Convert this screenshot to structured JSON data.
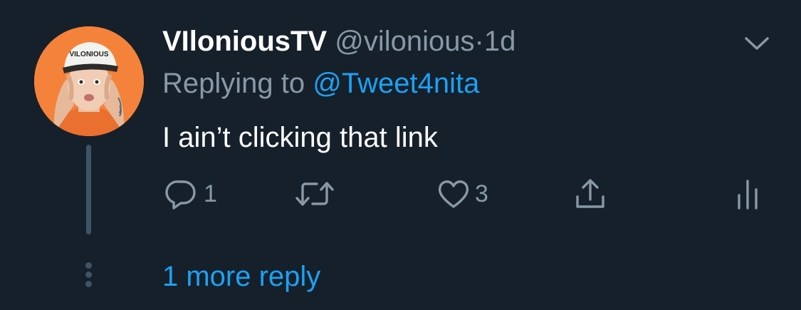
{
  "tweet": {
    "author": {
      "display_name": "VIloniousTV",
      "handle": "@vilonious",
      "avatar_cap_text": "VILONIOUS"
    },
    "separator": "·",
    "timestamp": "1d",
    "replying_prefix": "Replying to",
    "replying_to": "@Tweet4nita",
    "text": "I ain’t clicking that link",
    "actions": {
      "reply_count": "1",
      "retweet_count": "",
      "like_count": "3"
    },
    "more_replies_label": "1 more reply"
  },
  "colors": {
    "background": "#15202b",
    "primary_text": "#ffffff",
    "secondary_text": "#8899a6",
    "link": "#1da1f2",
    "thread_line": "#3d5466",
    "avatar_bg": "#f5823a"
  },
  "icons": {
    "menu": "chevron-down-icon",
    "reply": "reply-icon",
    "retweet": "retweet-icon",
    "like": "heart-icon",
    "share": "share-icon",
    "analytics": "analytics-icon",
    "more": "vertical-dots-icon"
  }
}
